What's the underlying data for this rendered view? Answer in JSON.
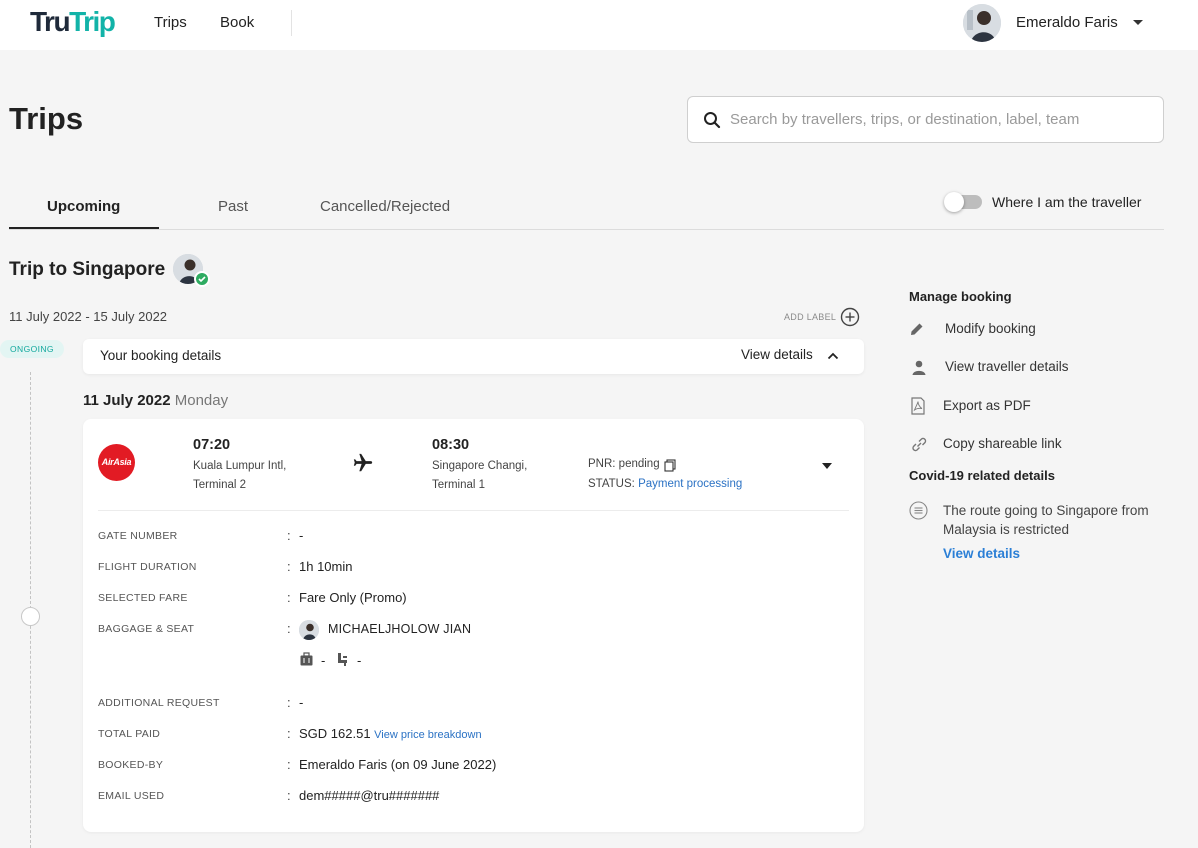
{
  "brand": {
    "part1": "Tru",
    "part2": "Trip",
    "accent": "#12b3a8"
  },
  "nav": {
    "items": [
      {
        "label": "Trips"
      },
      {
        "label": "Book"
      }
    ]
  },
  "user": {
    "name": "Emeraldo Faris"
  },
  "page": {
    "title": "Trips"
  },
  "search": {
    "placeholder": "Search by travellers, trips, or destination, label, team",
    "value": ""
  },
  "tabs": [
    {
      "label": "Upcoming",
      "active": true
    },
    {
      "label": "Past",
      "active": false
    },
    {
      "label": "Cancelled/Rejected",
      "active": false
    }
  ],
  "filter": {
    "label": "Where I am the traveller",
    "on": false
  },
  "trip": {
    "title": "Trip to Singapore",
    "dates": "11 July 2022 - 15 July 2022",
    "status_badge": "ONGOING",
    "add_label": "ADD LABEL",
    "booking_bar": {
      "label": "Your booking details",
      "view_label": "View details"
    },
    "day": {
      "date": "11 July 2022",
      "weekday": "Monday"
    }
  },
  "flight": {
    "airline_logo_text": "AirAsia",
    "departure": {
      "time": "07:20",
      "airport": "Kuala Lumpur Intl,",
      "terminal": "Terminal 2"
    },
    "arrival": {
      "time": "08:30",
      "airport": "Singapore Changi,",
      "terminal": "Terminal 1"
    },
    "pnr": "PNR: pending",
    "status_label": "STATUS:",
    "status_value": "Payment processing",
    "details": {
      "gate": {
        "label": "GATE NUMBER",
        "value": "-"
      },
      "duration": {
        "label": "FLIGHT DURATION",
        "value": "1h 10min"
      },
      "fare": {
        "label": "SELECTED FARE",
        "value": "Fare Only (Promo)"
      },
      "baggage": {
        "label": "BAGGAGE & SEAT",
        "passenger": "MICHAELJHOLOW JIAN",
        "baggage": "-",
        "seat": "-"
      },
      "request": {
        "label": "ADDITIONAL REQUEST",
        "value": "-"
      },
      "total": {
        "label": "TOTAL PAID",
        "value": "SGD 162.51",
        "link": "View price breakdown"
      },
      "booked_by": {
        "label": "BOOKED-BY",
        "value": "Emeraldo Faris (on 09 June 2022)"
      },
      "email": {
        "label": "EMAIL USED",
        "value": "dem#####@tru#######"
      }
    }
  },
  "manage": {
    "heading": "Manage booking",
    "items": [
      {
        "label": "Modify booking",
        "icon": "pencil-icon"
      },
      {
        "label": "View traveller details",
        "icon": "person-icon"
      },
      {
        "label": "Export as PDF",
        "icon": "pdf-icon"
      },
      {
        "label": "Copy shareable link",
        "icon": "link-icon"
      }
    ]
  },
  "covid": {
    "heading": "Covid-19 related details",
    "text": "The route going to Singapore from Malaysia is restricted",
    "link": "View details"
  }
}
